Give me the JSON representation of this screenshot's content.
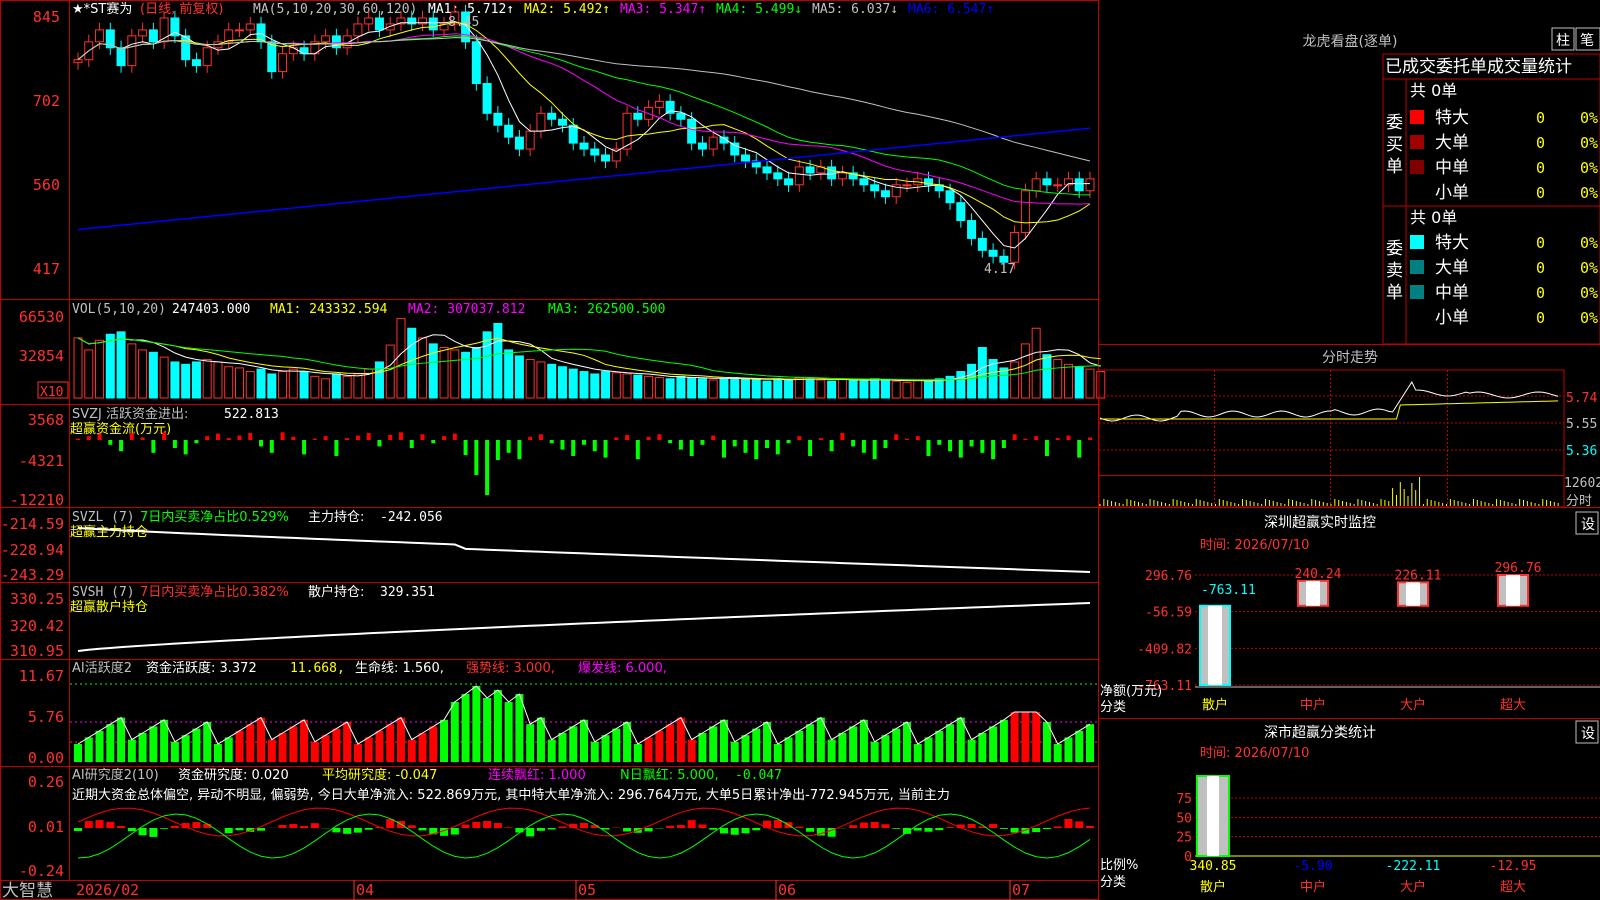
{
  "stock": {
    "name": "★*ST赛为",
    "mode": "(日线, 前复权)",
    "ma_label": "MA(5,10,20,30,60,120)"
  },
  "ma_values": [
    {
      "label": "MA1:",
      "value": "5.712",
      "arrow": "↑",
      "color": "#ffffff"
    },
    {
      "label": "MA2:",
      "value": "5.492",
      "arrow": "↑",
      "color": "#ffff00"
    },
    {
      "label": "MA3:",
      "value": "5.347",
      "arrow": "↑",
      "color": "#ff00ff"
    },
    {
      "label": "MA4:",
      "value": "5.499",
      "arrow": "↓",
      "color": "#00ff00"
    },
    {
      "label": "MA5:",
      "value": "6.037",
      "arrow": "↓",
      "color": "#c0c0c0"
    },
    {
      "label": "MA6:",
      "value": "6.547",
      "arrow": "↑",
      "color": "#0000ff"
    }
  ],
  "price_axis": [
    "845",
    "702",
    "560",
    "417"
  ],
  "price_marks": {
    "high": "8.45",
    "low": "4.17"
  },
  "vol": {
    "title": "VOL(5,10,20)",
    "value": "247403.000",
    "ma1": "MA1: 243332.594",
    "ma2": "MA2: 307037.812",
    "ma3": "MA3: 262500.500",
    "axis": [
      "66530",
      "32854"
    ],
    "unit": "X10"
  },
  "svzj": {
    "title": "SVZJ  活跃资金进出:",
    "value": "522.813",
    "sub": "超赢资金流(万元)",
    "axis": [
      "3568",
      "-4321",
      "-12210"
    ]
  },
  "svzl": {
    "title": "SVZL (7)",
    "ratio": "7日内买卖净占比0.529%",
    "pos": "主力持仓:",
    "value": "-242.056",
    "sub": "超赢主力持仓",
    "axis": [
      "-214.59",
      "-228.94",
      "-243.29"
    ]
  },
  "svsh": {
    "title": "SVSH (7)",
    "ratio": "7日内买卖净占比0.382%",
    "pos": "散户持仓:",
    "value": "329.351",
    "sub": "超赢散户持仓",
    "axis": [
      "330.25",
      "320.42",
      "310.95"
    ]
  },
  "ai_active": {
    "title": "AI活跃度2",
    "a": "资金活跃度: 3.372",
    "b": "11.668,",
    "c": "生命线: 1.560,",
    "d": "强势线: 3.000,",
    "e": "爆发线: 6.000,",
    "axis": [
      "11.67",
      "5.76",
      "0.00"
    ]
  },
  "ai_research": {
    "title": "AI研究度2(10)",
    "a": "资金研究度: 0.020",
    "b": "平均研究度: -0.047",
    "c": "连续飘红: 1.000",
    "d": "N日飘红: 5.000,",
    "e": "-0.047",
    "note": "近期大资金总体偏空, 异动不明显, 偏弱势, 今日大单净流入: 522.869万元, 其中特大单净流入: 296.764万元, 大单5日累计净出-772.945万元, 当前主力",
    "axis": [
      "0.26",
      "0.01",
      "-0.24"
    ]
  },
  "date_axis": [
    "2026/02",
    "04",
    "05",
    "06",
    "07"
  ],
  "logo": "大智慧",
  "dragon": {
    "title": "龙虎看盘(逐单)",
    "btn1": "柱",
    "btn2": "笔",
    "header": "已成交委托单成交量统计",
    "buy_label": "委买单",
    "sell_label": "委卖单",
    "buy_total": "共 0单",
    "sell_total": "共 0单",
    "buy_rows": [
      {
        "name": "特大",
        "val": "0",
        "pct": "0%",
        "color": "#ff0000"
      },
      {
        "name": "大单",
        "val": "0",
        "pct": "0%",
        "color": "#a00000"
      },
      {
        "name": "中单",
        "val": "0",
        "pct": "0%",
        "color": "#800000"
      },
      {
        "name": "小单",
        "val": "0",
        "pct": "0%",
        "color": "none"
      }
    ],
    "sell_rows": [
      {
        "name": "特大",
        "val": "0",
        "pct": "0%",
        "color": "#00ffff"
      },
      {
        "name": "大单",
        "val": "0",
        "pct": "0%",
        "color": "#008080"
      },
      {
        "name": "中单",
        "val": "0",
        "pct": "0%",
        "color": "#008080"
      },
      {
        "name": "小单",
        "val": "0",
        "pct": "0%",
        "color": "none"
      }
    ]
  },
  "intraday": {
    "title": "分时走势",
    "axis": [
      "5.74",
      "5.55",
      "5.36"
    ],
    "vol_top": "12602",
    "vol_label": "分时"
  },
  "monitor": {
    "title": "深圳超赢实时监控",
    "set": "设",
    "time": "时间: 2026/07/10",
    "axis": [
      "296.76",
      "-56.59",
      "-409.82",
      "-763.11"
    ],
    "cats": [
      "散户",
      "中户",
      "大户",
      "超大"
    ],
    "values": [
      -763.11,
      240.24,
      226.11,
      296.76
    ],
    "labels": [
      "-763.11",
      "240.24",
      "226.11",
      "296.76"
    ],
    "y_label": "净额(万元)",
    "x_label": "分类"
  },
  "classify": {
    "title": "深市超赢分类统计",
    "set": "设",
    "time": "时间: 2026/07/10",
    "axis": [
      "75",
      "50",
      "25",
      "0"
    ],
    "cats": [
      "散户",
      "中户",
      "大户",
      "超大"
    ],
    "values": [
      340.85,
      -5.9,
      -222.11,
      -12.95
    ],
    "labels": [
      "340.85",
      "-5.90",
      "-222.11",
      "-12.95"
    ],
    "y_label": "比例%",
    "x_label": "分类"
  },
  "chart_data": [
    {
      "type": "candlestick",
      "title": "★*ST赛为 (日线, 前复权)",
      "ylim": [
        4.17,
        8.45
      ],
      "y_ticks": [
        8.45,
        7.02,
        5.6,
        4.17
      ],
      "high": 8.45,
      "low": 4.17,
      "close": [
        7.7,
        8.0,
        8.2,
        7.9,
        7.6,
        8.1,
        8.2,
        8.0,
        8.4,
        8.1,
        7.7,
        7.6,
        7.9,
        8.0,
        8.2,
        8.2,
        8.3,
        8.0,
        7.5,
        7.8,
        7.9,
        7.8,
        8.0,
        8.1,
        7.9,
        8.1,
        8.3,
        8.4,
        8.2,
        8.3,
        8.4,
        8.3,
        8.4,
        8.2,
        8.3,
        8.5,
        8.0,
        7.3,
        6.8,
        6.6,
        6.4,
        6.2,
        6.5,
        6.8,
        6.7,
        6.6,
        6.3,
        6.2,
        6.1,
        6.0,
        6.2,
        6.8,
        6.7,
        6.9,
        7.0,
        6.8,
        6.7,
        6.3,
        6.2,
        6.4,
        6.3,
        6.1,
        6.0,
        5.9,
        5.8,
        5.7,
        5.6,
        5.9,
        5.8,
        5.9,
        5.7,
        5.8,
        5.7,
        5.6,
        5.5,
        5.4,
        5.6,
        5.6,
        5.7,
        5.6,
        5.5,
        5.3,
        5.0,
        4.7,
        4.5,
        4.4,
        4.3,
        4.8,
        5.5,
        5.7,
        5.6,
        5.6,
        5.7,
        5.5,
        5.7
      ],
      "ma_values": {
        "MA1": 5.712,
        "MA2": 5.492,
        "MA3": 5.347,
        "MA4": 5.499,
        "MA5": 6.037,
        "MA6": 6.547
      }
    },
    {
      "type": "bar",
      "title": "VOL(5,10,20)",
      "ylim": [
        0,
        66530
      ],
      "y_ticks": [
        66530,
        32854
      ],
      "values": [
        50000,
        40000,
        48000,
        53000,
        55000,
        45000,
        40000,
        38000,
        34000,
        30000,
        28000,
        30000,
        32000,
        30000,
        26000,
        25000,
        22000,
        24000,
        20000,
        22000,
        24000,
        22000,
        18000,
        16000,
        20000,
        18000,
        20000,
        24000,
        30000,
        44000,
        66000,
        58000,
        50000,
        45000,
        42000,
        40000,
        38000,
        42000,
        55000,
        62000,
        40000,
        35000,
        32000,
        30000,
        28000,
        26000,
        24000,
        22000,
        20000,
        22000,
        21000,
        20000,
        19000,
        18000,
        17000,
        16000,
        18000,
        17000,
        16000,
        15000,
        16000,
        17000,
        16000,
        15000,
        14000,
        16000,
        15000,
        17000,
        16000,
        15000,
        14000,
        16000,
        15000,
        14000,
        16000,
        15000,
        14000,
        13000,
        15000,
        14000,
        16000,
        18000,
        22000,
        28000,
        42000,
        32000,
        25000,
        30000,
        45000,
        58000,
        36000,
        32000,
        28000,
        26000,
        24000,
        22000
      ],
      "last": 247403.0,
      "ma": {
        "MA1": 243332.594,
        "MA2": 307037.812,
        "MA3": 262500.5
      }
    }
  ]
}
